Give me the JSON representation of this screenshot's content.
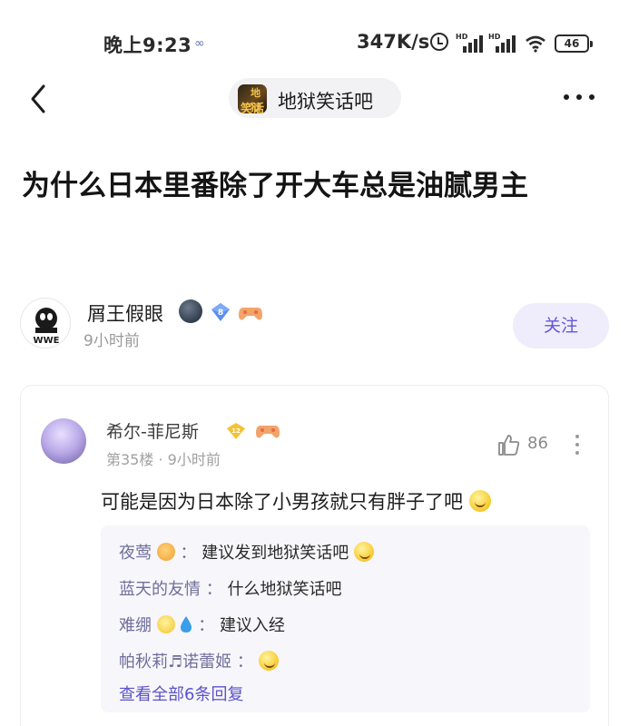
{
  "status_bar": {
    "time": "晚上9:23",
    "speed": "347K/s",
    "battery": "46"
  },
  "nav": {
    "forum_name": "地狱笑话吧",
    "forum_icon_text_top": "地狱",
    "forum_icon_text_bottom": "笑话"
  },
  "post": {
    "title": "为什么日本里番除了开大车总是油腻男主"
  },
  "author": {
    "name": "屑王假眼",
    "level": "8",
    "time": "9小时前",
    "follow_label": "关注",
    "avatar_text": "WWE"
  },
  "comment": {
    "user": "希尔-菲尼斯",
    "level": "12",
    "floor": "第35楼",
    "time": "9小时前",
    "likes": "86",
    "text": "可能是因为日本除了小男孩就只有胖子了吧",
    "replies": [
      {
        "name": "夜莺",
        "text": "建议发到地狱笑话吧"
      },
      {
        "name": "蓝天的友情",
        "text": "什么地狱笑话吧"
      },
      {
        "name": "难绷",
        "text": "建议入经"
      },
      {
        "name": "帕秋莉♬诺蕾姬",
        "text": ""
      }
    ],
    "view_all": "查看全部6条回复"
  },
  "colors": {
    "accent": "#6256d8",
    "follow_bg": "#efedfb",
    "reply_name": "#6f6f9a",
    "reply_bg": "#f7f6fb"
  }
}
